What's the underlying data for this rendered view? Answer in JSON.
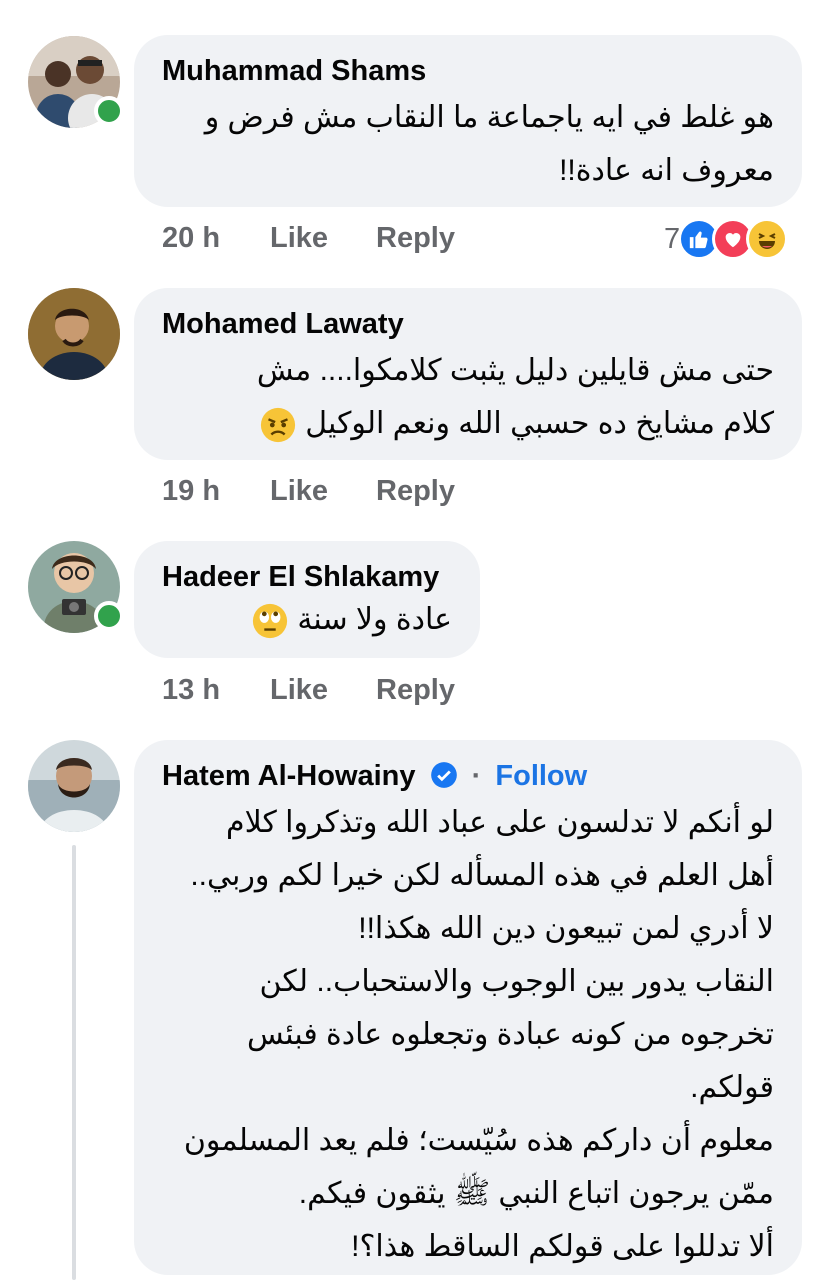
{
  "comments": [
    {
      "author": "Muhammad Shams",
      "lines": [
        "هو غلط في ايه ياجماعة ما النقاب مش فرض و",
        "معروف انه عادة!!"
      ],
      "time": "20 h",
      "like_label": "Like",
      "reply_label": "Reply",
      "reaction_count": "7",
      "reactions": [
        "like-reaction-icon",
        "love-reaction-icon",
        "haha-reaction-icon"
      ],
      "online": true
    },
    {
      "author": "Mohamed Lawaty",
      "lines": [
        "حتى مش قايلين دليل يثبت كلامكوا.... مش",
        "كلام مشايخ ده حسبي الله ونعم الوكيل"
      ],
      "emoji": "angry-face-emoji",
      "time": "19 h",
      "like_label": "Like",
      "reply_label": "Reply",
      "online": false
    },
    {
      "author": "Hadeer El Shlakamy",
      "lines": [
        "عادة ولا سنة"
      ],
      "emoji": "eye-roll-emoji",
      "time": "13 h",
      "like_label": "Like",
      "reply_label": "Reply",
      "online": true
    },
    {
      "author": "Hatem Al-Howainy",
      "verified": true,
      "separator": "·",
      "follow_label": "Follow",
      "lines": [
        "لو أنكم لا تدلسون على عباد الله وتذكروا كلام",
        "أهل العلم في هذه المسأله لكن خيرا لكم وربي..",
        "لا أدري لمن تبيعون دين الله هكذا!!",
        "النقاب يدور بين الوجوب والاستحباب.. لكن",
        "تخرجوه من كونه عبادة وتجعلوه عادة فبئس",
        "قولكم.",
        "معلوم أن داركم هذه سُيّست؛ فلم يعد المسلمون",
        "ممّن يرجون اتباع النبي ﷺ يثقون فيكم.",
        "ألا تدللوا على قولكم الساقط هذا؟!"
      ],
      "online": false
    }
  ],
  "colors": {
    "bubble": "#f0f2f5",
    "text": "#050505",
    "meta": "#65676b",
    "online": "#31a24c",
    "link": "#1b74e4"
  }
}
